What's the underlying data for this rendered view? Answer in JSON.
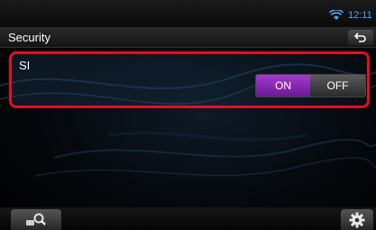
{
  "status": {
    "time": "12:11"
  },
  "header": {
    "title": "Security"
  },
  "setting": {
    "label": "SI",
    "on_label": "ON",
    "off_label": "OFF",
    "selected": "ON"
  },
  "icons": {
    "wifi": "wifi-icon",
    "back": "back-arrow-icon",
    "search": "search-icon",
    "settings": "gear-icon"
  },
  "colors": {
    "accent_on": "#8a2bbf",
    "highlight_border": "#e01024",
    "clock": "#48a8ff"
  }
}
